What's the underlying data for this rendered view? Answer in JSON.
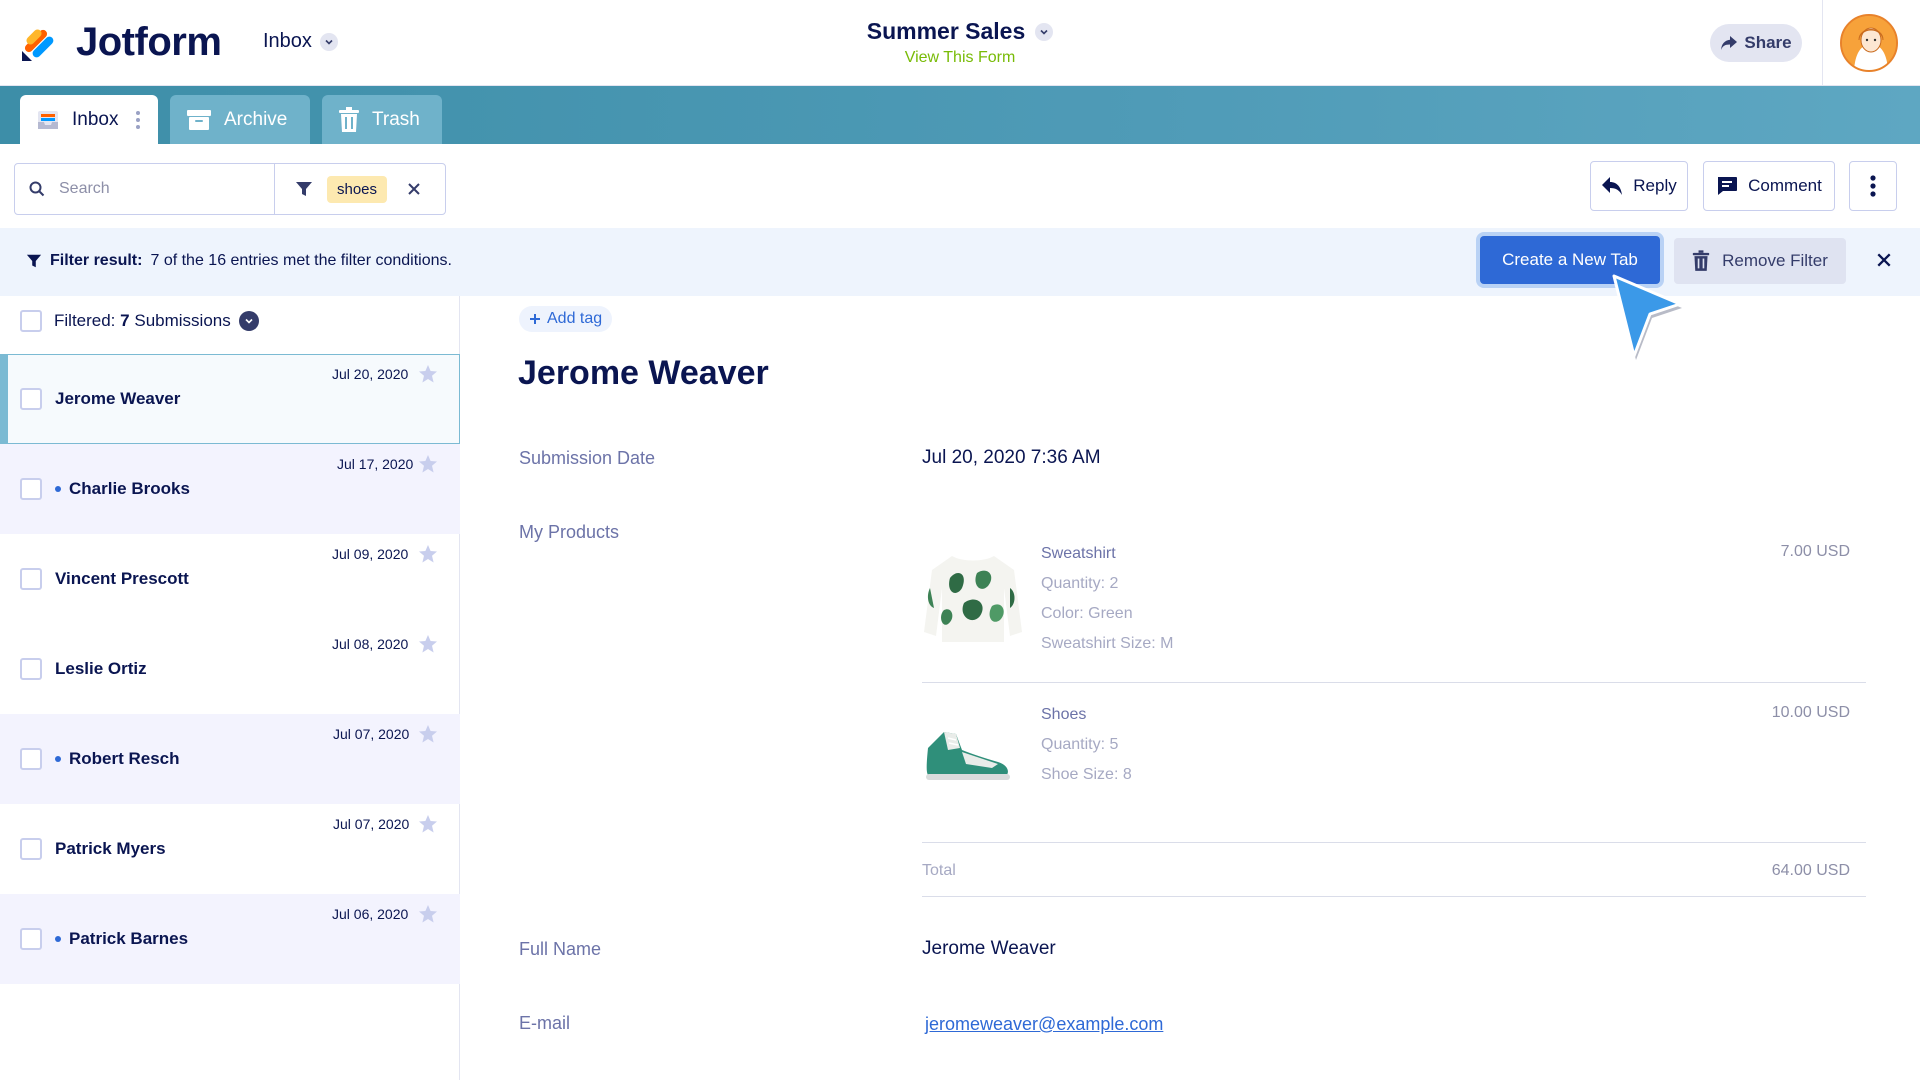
{
  "header": {
    "brand": "Jotform",
    "inbox_select": "Inbox",
    "form_title": "Summer Sales",
    "view_form": "View This Form",
    "share": "Share"
  },
  "tabs": [
    {
      "label": "Inbox",
      "icon": "inbox-icon",
      "active": true
    },
    {
      "label": "Archive",
      "icon": "archive-icon",
      "active": false
    },
    {
      "label": "Trash",
      "icon": "trash-icon",
      "active": false
    }
  ],
  "search": {
    "placeholder": "Search",
    "filter_chip": "shoes"
  },
  "toolbar": {
    "reply": "Reply",
    "comment": "Comment"
  },
  "filter_banner": {
    "label": "Filter result:",
    "message": "7 of the 16 entries met the filter conditions.",
    "create_tab": "Create a New Tab",
    "remove_filter": "Remove Filter"
  },
  "list": {
    "header_prefix": "Filtered:",
    "header_count": "7",
    "header_suffix": "Submissions",
    "rows": [
      {
        "name": "Jerome Weaver",
        "date": "Jul 20, 2020",
        "unread": false,
        "selected": true
      },
      {
        "name": "Charlie Brooks",
        "date": "Jul 17, 2020",
        "unread": true,
        "selected": false
      },
      {
        "name": "Vincent Prescott",
        "date": "Jul 09, 2020",
        "unread": false,
        "selected": false
      },
      {
        "name": "Leslie Ortiz",
        "date": "Jul 08, 2020",
        "unread": false,
        "selected": false
      },
      {
        "name": "Robert Resch",
        "date": "Jul 07, 2020",
        "unread": true,
        "selected": false
      },
      {
        "name": "Patrick Myers",
        "date": "Jul 07, 2020",
        "unread": false,
        "selected": false
      },
      {
        "name": "Patrick Barnes",
        "date": "Jul 06, 2020",
        "unread": true,
        "selected": false
      }
    ]
  },
  "detail": {
    "add_tag": "Add tag",
    "title": "Jerome Weaver",
    "submission_date_label": "Submission Date",
    "submission_date": "Jul 20, 2020 7:36 AM",
    "products_label": "My Products",
    "products": [
      {
        "name": "Sweatshirt",
        "meta": [
          "Quantity: 2",
          "Color: Green",
          "Sweatshirt Size: M"
        ],
        "price": "7.00 USD"
      },
      {
        "name": "Shoes",
        "meta": [
          "Quantity: 5",
          "Shoe Size: 8"
        ],
        "price": "10.00 USD"
      }
    ],
    "total_label": "Total",
    "total": "64.00 USD",
    "full_name_label": "Full Name",
    "full_name": "Jerome Weaver",
    "email_label": "E-mail",
    "email": "jeromeweaver@example.com"
  },
  "colors": {
    "accent": "#2e69d6",
    "tabstrip": "#4f9bb7",
    "view_form": "#78bb07"
  }
}
